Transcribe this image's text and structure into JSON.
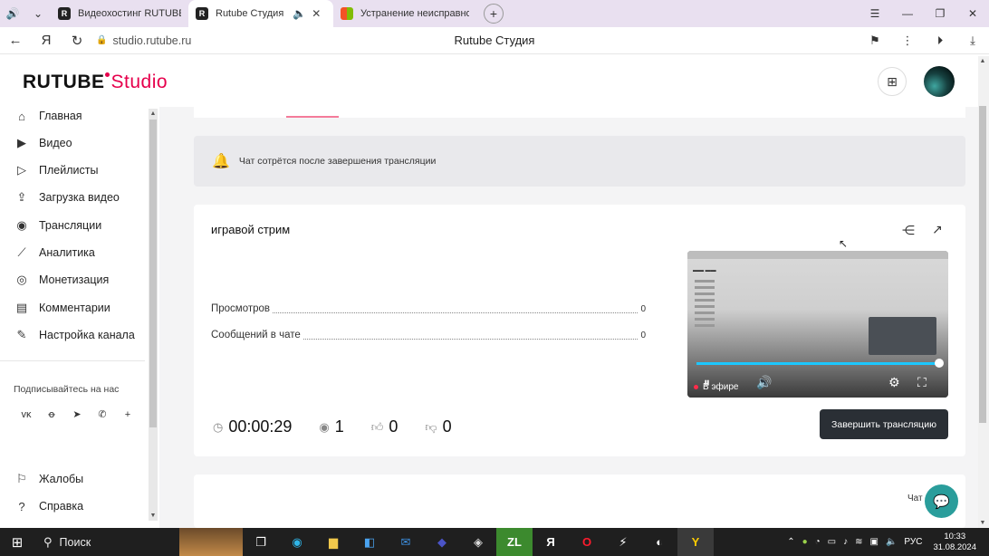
{
  "browser": {
    "tabs": [
      {
        "label": "Видеохостинг RUTUBE. С",
        "favicon": "rutube-icon",
        "active": false
      },
      {
        "label": "Rutube Студия",
        "favicon": "rutube-icon",
        "active": true
      },
      {
        "label": "Устранение неисправност",
        "favicon": "microsoft-icon",
        "active": false
      }
    ],
    "url": "studio.rutube.ru",
    "page_title": "Rutube Студия"
  },
  "app": {
    "logo_main": "RUTUBE",
    "logo_studio": "Studio",
    "accent": "#e6004c"
  },
  "sidebar": {
    "items": [
      {
        "label": "Главная",
        "icon": "home-icon"
      },
      {
        "label": "Видео",
        "icon": "video-icon"
      },
      {
        "label": "Плейлисты",
        "icon": "playlist-icon"
      },
      {
        "label": "Загрузка видео",
        "icon": "upload-icon"
      },
      {
        "label": "Трансляции",
        "icon": "broadcast-icon"
      },
      {
        "label": "Аналитика",
        "icon": "analytics-icon"
      },
      {
        "label": "Монетизация",
        "icon": "monetization-icon"
      },
      {
        "label": "Комментарии",
        "icon": "comments-icon"
      },
      {
        "label": "Настройка канала",
        "icon": "settings-icon"
      }
    ],
    "social_label": "Подписывайтесь на нас",
    "bottom_items": [
      {
        "label": "Жалобы",
        "icon": "flag-icon"
      },
      {
        "label": "Справка",
        "icon": "help-icon"
      }
    ]
  },
  "notice": {
    "text": "Чат сотрётся после завершения трансляции"
  },
  "stream": {
    "title": "игравой стрим",
    "stats": [
      {
        "label": "Просмотров",
        "value": "0"
      },
      {
        "label": "Сообщений в чате",
        "value": "0"
      }
    ],
    "metrics": {
      "duration": "00:00:29",
      "viewers": "1",
      "likes": "0",
      "dislikes": "0"
    },
    "preview": {
      "live_label": "В эфире",
      "progress": 1.0
    },
    "end_button": "Завершить трансляцию"
  },
  "chat": {
    "label": "Чат"
  },
  "taskbar": {
    "search": "Поиск",
    "lang": "РУС",
    "time": "10:33",
    "date": "31.08.2024"
  }
}
